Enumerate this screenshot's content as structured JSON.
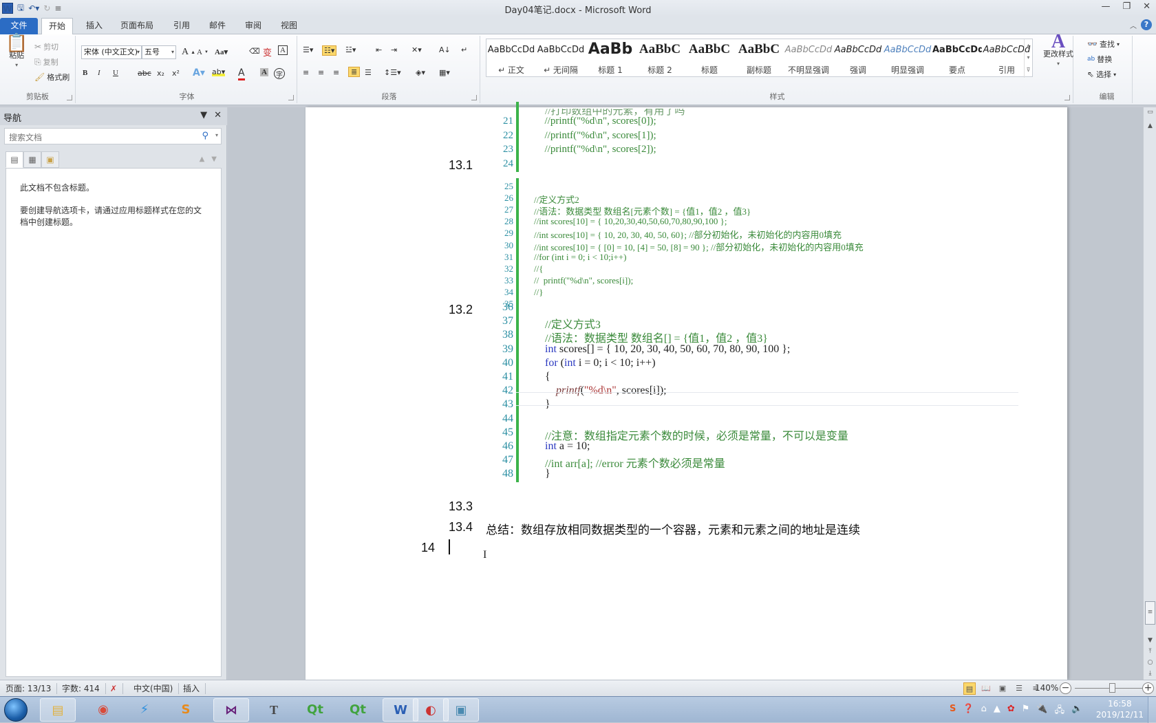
{
  "window": {
    "title": "Day04笔记.docx - Microsoft Word",
    "controls": {
      "minimize": "minimize",
      "restore": "restore",
      "close": "close"
    }
  },
  "quick_access": [
    "word-logo",
    "save-icon",
    "undo-icon",
    "redo-icon",
    "customize-icon"
  ],
  "tabs": [
    {
      "label": "文件"
    },
    {
      "label": "开始",
      "active": true
    },
    {
      "label": "插入"
    },
    {
      "label": "页面布局"
    },
    {
      "label": "引用"
    },
    {
      "label": "邮件"
    },
    {
      "label": "审阅"
    },
    {
      "label": "视图"
    }
  ],
  "ribbon": {
    "clipboard": {
      "label": "剪贴板",
      "paste": "粘贴",
      "cut": "剪切",
      "copy": "复制",
      "format_painter": "格式刷"
    },
    "font": {
      "label": "字体",
      "font_name": "宋体 (中文正文)",
      "font_size": "五号",
      "grow": "A",
      "shrink": "A",
      "case": "Aa",
      "bold": "B",
      "italic": "I",
      "underline": "U",
      "strike": "abc",
      "subscript": "x₂",
      "superscript": "x²"
    },
    "paragraph": {
      "label": "段落"
    },
    "styles": {
      "label": "样式",
      "items": [
        {
          "preview": "AaBbCcDd",
          "name": "↵ 正文"
        },
        {
          "preview": "AaBbCcDd",
          "name": "↵ 无间隔"
        },
        {
          "preview": "AaBb",
          "name": "标题 1"
        },
        {
          "preview": "AaBbC",
          "name": "标题 2"
        },
        {
          "preview": "AaBbC",
          "name": "标题"
        },
        {
          "preview": "AaBbC",
          "name": "副标题"
        },
        {
          "preview": "AaBbCcDd",
          "name": "不明显强调"
        },
        {
          "preview": "AaBbCcDd",
          "name": "强调"
        },
        {
          "preview": "AaBbCcDd",
          "name": "明显强调"
        },
        {
          "preview": "AaBbCcDd",
          "name": "要点"
        },
        {
          "preview": "AaBbCcDd",
          "name": "引用"
        }
      ],
      "change_styles": "更改样式"
    },
    "editing": {
      "label": "编辑",
      "find": "查找",
      "replace": "替换",
      "select": "选择"
    }
  },
  "nav_pane": {
    "title": "导航",
    "search_placeholder": "搜索文档",
    "message1": "此文档不包含标题。",
    "message2": "要创建导航选项卡，请通过应用标题样式在您的文档中创建标题。"
  },
  "document": {
    "headings": [
      {
        "num": "13.1"
      },
      {
        "num": "13.2"
      },
      {
        "num": "13.3"
      },
      {
        "num": "13.4",
        "text": "总结：数组存放相同数据类型的一个容器，元素和元素之间的地址是连续"
      },
      {
        "num": "14"
      }
    ],
    "block1": [
      {
        "n": "21",
        "code": "  //printf(\"%d\\n\", scores[0]);"
      },
      {
        "n": "22",
        "code": "  //printf(\"%d\\n\", scores[1]);"
      },
      {
        "n": "23",
        "code": "  //printf(\"%d\\n\", scores[2]);"
      },
      {
        "n": "24",
        "code": ""
      }
    ],
    "block2": [
      {
        "n": "25",
        "code": ""
      },
      {
        "n": "26",
        "code": "//定义方式2"
      },
      {
        "n": "27",
        "code": "//语法：数据类型 数组名[元素个数] = {值1，值2 ，值3}"
      },
      {
        "n": "28",
        "code": "//int scores[10] = { 10,20,30,40,50,60,70,80,90,100 };"
      },
      {
        "n": "29",
        "code": "//int scores[10] = { 10, 20, 30, 40, 50, 60}; //部分初始化，未初始化的内容用0填充"
      },
      {
        "n": "30",
        "code": "//int scores[10] = { [0] = 10, [4] = 50, [8] = 90 }; //部分初始化，未初始化的内容用0填充"
      },
      {
        "n": "31",
        "code": "//for (int i = 0; i < 10;i++)"
      },
      {
        "n": "32",
        "code": "//{"
      },
      {
        "n": "33",
        "code": "//  printf(\"%d\\n\", scores[i]);"
      },
      {
        "n": "34",
        "code": "//}"
      },
      {
        "n": "35",
        "code": ""
      }
    ],
    "block3": [
      {
        "n": "36",
        "code": ""
      },
      {
        "n": "37",
        "code": "//定义方式3"
      },
      {
        "n": "38",
        "code": "//语法：数据类型 数组名[] = {值1，值2 ，值3}"
      },
      {
        "n": "39",
        "code": "int scores[] = { 10, 20, 30, 40, 50, 60, 70, 80, 90, 100 };"
      },
      {
        "n": "40",
        "code": "for (int i = 0; i < 10; i++)"
      },
      {
        "n": "41",
        "code": "{"
      },
      {
        "n": "42",
        "code": "    printf(\"%d\\n\", scores[i]);"
      },
      {
        "n": "43",
        "code": "}"
      },
      {
        "n": "44",
        "code": ""
      },
      {
        "n": "45",
        "code": "//注意：数组指定元素个数的时候，必须是常量，不可以是变量"
      },
      {
        "n": "46",
        "code": "int a = 10;"
      },
      {
        "n": "47",
        "code": "//int arr[a]; //error 元素个数必须是常量"
      },
      {
        "n": "48",
        "code": "}"
      }
    ],
    "partial_line_top": "//打印数组中的元素，有用了吗"
  },
  "statusbar": {
    "page": "页面: 13/13",
    "words": "字数: 414",
    "language": "中文(中国)",
    "mode": "插入",
    "zoom": "140%",
    "zoom_value_percent": 140
  },
  "taskbar": {
    "apps": [
      "explorer",
      "chrome",
      "thunder",
      "sublime-text",
      "visual-studio",
      "typora",
      "qt-creator",
      "qt-designer",
      "word",
      "network-tool",
      "photo-viewer"
    ],
    "clock_time": "16:58",
    "clock_date": "2019/12/11"
  }
}
